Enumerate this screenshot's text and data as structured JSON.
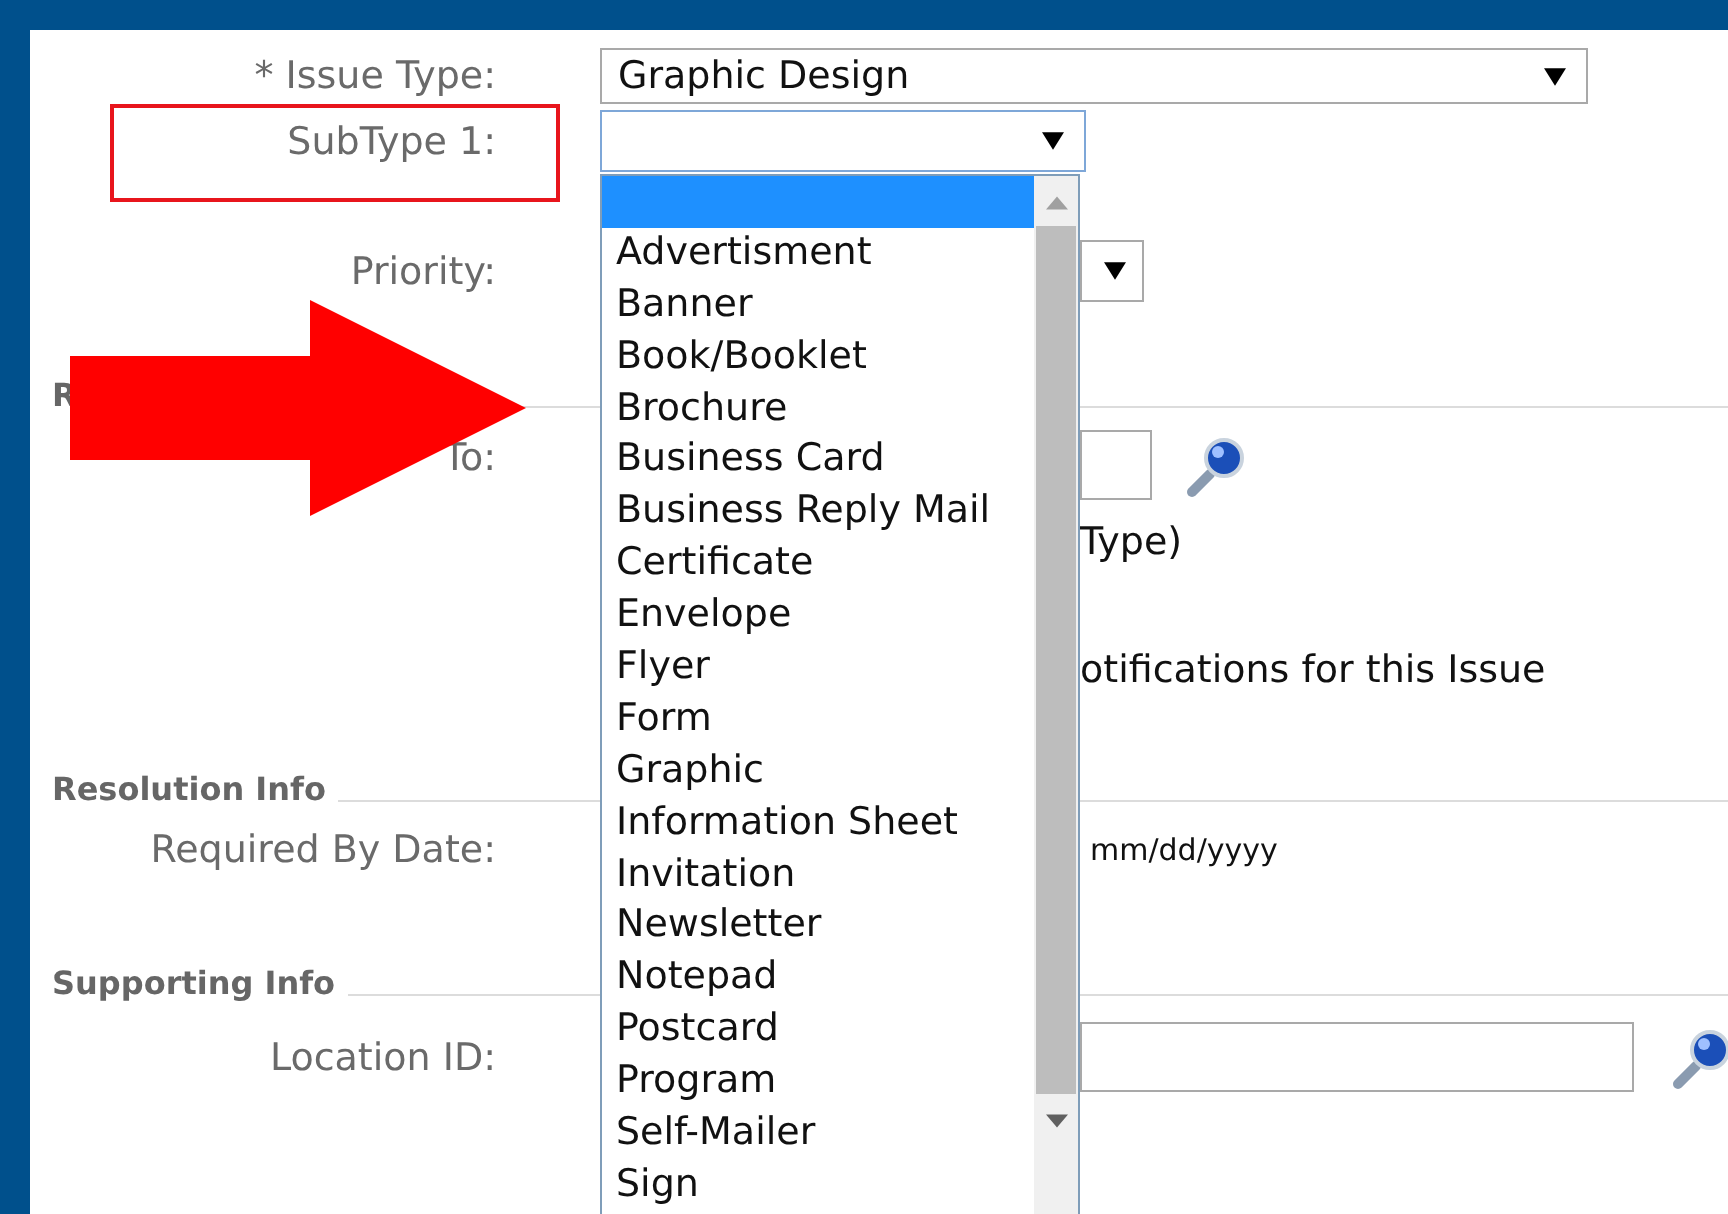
{
  "form": {
    "issue_type": {
      "label": "* Issue Type:",
      "value": "Graphic Design"
    },
    "subtype_1": {
      "label": "SubType 1:",
      "highlighted": true
    },
    "priority": {
      "label": "Priority:"
    },
    "section_1": {
      "title": "R"
    },
    "assigned_to": {
      "label_end": "To:"
    },
    "type_note": "Type)",
    "notifications_text": "otifications for this Issue",
    "section_2": {
      "title": "Resolution Info"
    },
    "required_by_date": {
      "label": "Required By Date:",
      "hint": "mm/dd/yyyy"
    },
    "section_3": {
      "title": "Supporting Info"
    },
    "location_id": {
      "label": "Location ID:"
    }
  },
  "subtype_dropdown": {
    "options": [
      {
        "selected": true
      },
      {
        "label": "Advertisment",
        "selected": false
      },
      {
        "label": "Banner",
        "selected": false
      },
      {
        "label": "Book/Booklet",
        "selected": false
      },
      {
        "label": "Brochure",
        "selected": false
      },
      {
        "label": "Business Card",
        "selected": false
      },
      {
        "label": "Business Reply Mail",
        "selected": false
      },
      {
        "label": "Certificate",
        "selected": false
      },
      {
        "label": "Envelope",
        "selected": false
      },
      {
        "label": "Flyer",
        "selected": false
      },
      {
        "label": "Form",
        "selected": false
      },
      {
        "label": "Graphic",
        "selected": false
      },
      {
        "label": "Information Sheet",
        "selected": false
      },
      {
        "label": "Invitation",
        "selected": false
      },
      {
        "label": "Newsletter",
        "selected": false
      },
      {
        "label": "Notepad",
        "selected": false
      },
      {
        "label": "Postcard",
        "selected": false
      },
      {
        "label": "Program",
        "selected": false
      },
      {
        "label": "Self-Mailer",
        "selected": false
      },
      {
        "label": "Sign",
        "selected": false
      }
    ]
  }
}
